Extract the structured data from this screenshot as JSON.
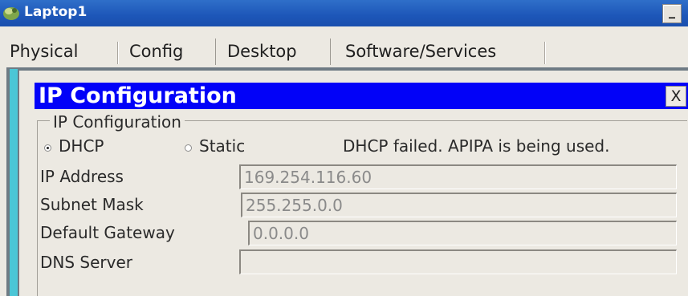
{
  "window": {
    "title": "Laptop1",
    "minimize_label": "_"
  },
  "tabs": [
    {
      "label": "Physical"
    },
    {
      "label": "Config"
    },
    {
      "label": "Desktop"
    },
    {
      "label": "Software/Services"
    }
  ],
  "dialog": {
    "title": "IP Configuration",
    "close_label": "X",
    "group_label": "IP Configuration",
    "mode": {
      "options": [
        "DHCP",
        "Static"
      ],
      "selected": "DHCP"
    },
    "status": "DHCP failed. APIPA is being used.",
    "fields": [
      {
        "label": "IP Address",
        "value": "169.254.116.60"
      },
      {
        "label": "Subnet Mask",
        "value": "255.255.0.0"
      },
      {
        "label": "Default Gateway",
        "value": "0.0.0.0"
      },
      {
        "label": "DNS Server",
        "value": ""
      }
    ]
  },
  "colors": {
    "titlebar": "#1d56b8",
    "dialog_title": "#0202f8",
    "cyan_edge": "#4bc6d6"
  }
}
